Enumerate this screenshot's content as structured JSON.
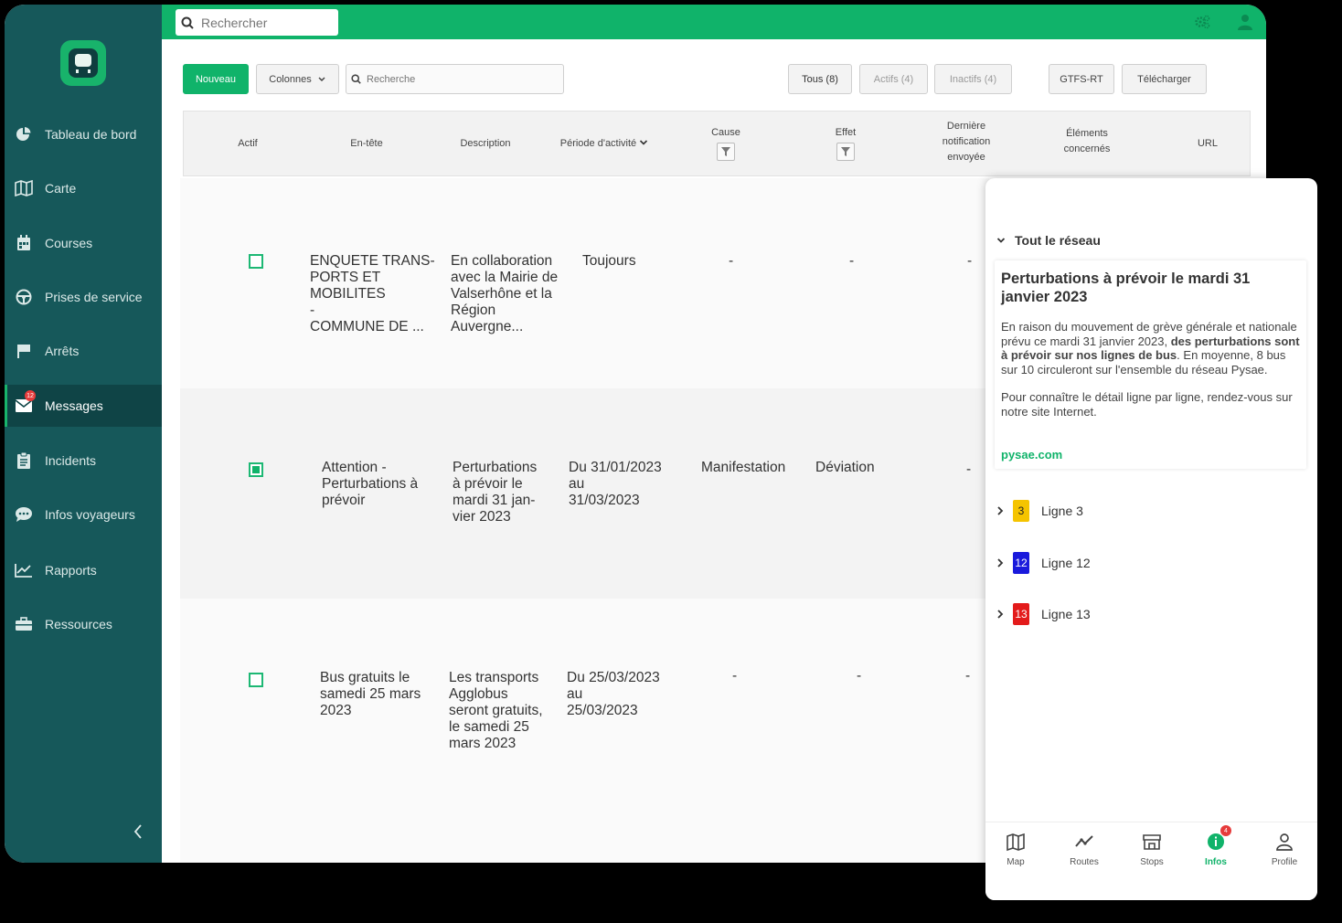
{
  "sidebar": {
    "items": [
      {
        "label": "Tableau de bord",
        "icon": "pie-chart-icon"
      },
      {
        "label": "Carte",
        "icon": "map-icon"
      },
      {
        "label": "Courses",
        "icon": "calendar-icon"
      },
      {
        "label": "Prises de service",
        "icon": "steering-wheel-icon"
      },
      {
        "label": "Arrêts",
        "icon": "stop-flag-icon"
      },
      {
        "label": "Messages",
        "icon": "envelope-icon",
        "badge": "12",
        "active": true
      },
      {
        "label": "Incidents",
        "icon": "clipboard-icon"
      },
      {
        "label": "Infos voyageurs",
        "icon": "chat-bubble-icon"
      },
      {
        "label": "Rapports",
        "icon": "line-chart-icon"
      },
      {
        "label": "Ressources",
        "icon": "toolbox-icon"
      }
    ]
  },
  "topbar": {
    "search_placeholder": "Rechercher"
  },
  "toolbar": {
    "new_label": "Nouveau",
    "columns_label": "Colonnes",
    "search_placeholder": "Recherche",
    "filter_all": "Tous (8)",
    "filter_active": "Actifs (4)",
    "filter_inactive": "Inactifs (4)",
    "gtfs_label": "GTFS-RT",
    "download_label": "Télécharger"
  },
  "table": {
    "headers": {
      "actif": "Actif",
      "entete": "En-tête",
      "description": "Description",
      "periode": "Période d'activité",
      "cause": "Cause",
      "effet": "Effet",
      "derniere_1": "Dernière",
      "derniere_2": "notification",
      "derniere_3": "envoyée",
      "elements_1": "Éléments",
      "elements_2": "concernés",
      "url": "URL"
    },
    "rows": [
      {
        "checked": false,
        "entete": "ENQUETE TRANS-\nPORTS ET MOBILITES\n-\nCOMMUNE DE ...",
        "description": "En collaboration\navec la Mairie de\nValserhône et la\nRégion\nAuvergne...",
        "periode": "Toujours",
        "cause": "-",
        "effet": "-",
        "derniere": "-"
      },
      {
        "checked": true,
        "entete": "Attention -\nPerturbations à\nprévoir",
        "description": "Perturbations\nà prévoir le\nmardi 31 jan-\nvier 2023",
        "periode": "Du 31/01/2023\nau\n31/03/2023",
        "cause": "Manifestation",
        "effet": "Déviation",
        "derniere": "-"
      },
      {
        "checked": false,
        "entete": "Bus gratuits le\nsamedi 25 mars\n2023",
        "description": "Les transports\nAgglobus\nseront gratuits,\nle samedi 25\nmars 2023",
        "periode": "Du 25/03/2023\nau\n25/03/2023",
        "cause": "-",
        "effet": "-",
        "derniere": "-"
      }
    ]
  },
  "preview": {
    "network_label": "Tout le réseau",
    "card": {
      "title": "Perturbations à prévoir le mardi 31 janvier 2023",
      "p1_a": "En raison du mouvement de grève générale et nationale prévu ce mardi 31 janvier 2023, ",
      "p1_bold": "des perturbations sont à prévoir sur nos lignes de bus",
      "p1_b": ". En moyenne, 8 bus sur 10 circuleront sur l'ensemble du réseau Pysae.",
      "p2": "Pour connaître le détail ligne par ligne, rendez-vous sur notre site Internet.",
      "link": "pysae.com"
    },
    "lines": [
      {
        "number": "3",
        "label": "Ligne 3",
        "color": "#f5c400",
        "text_color": "#222"
      },
      {
        "number": "12",
        "label": "Ligne 12",
        "color": "#1a1adc",
        "text_color": "#fff"
      },
      {
        "number": "13",
        "label": "Ligne 13",
        "color": "#e31b1b",
        "text_color": "#fff"
      }
    ],
    "bottom_nav": [
      {
        "label": "Map",
        "icon": "map-icon"
      },
      {
        "label": "Routes",
        "icon": "routes-icon"
      },
      {
        "label": "Stops",
        "icon": "store-icon"
      },
      {
        "label": "Infos",
        "icon": "info-icon",
        "badge": "4",
        "active": true
      },
      {
        "label": "Profile",
        "icon": "person-icon"
      }
    ]
  },
  "colors": {
    "brand_green": "#10b36a",
    "sidebar_bg": "#16585a",
    "alert_red": "#e63b3b"
  }
}
